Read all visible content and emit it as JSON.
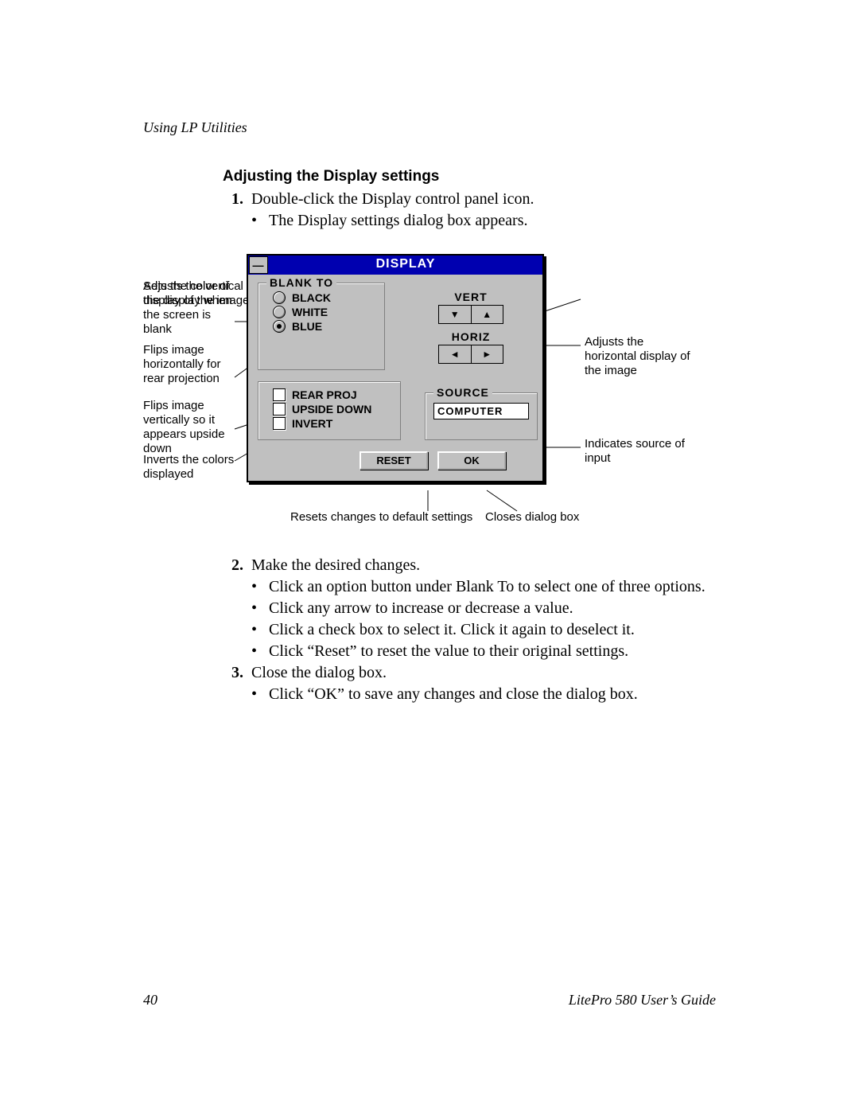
{
  "header": {
    "running": "Using LP Utilities"
  },
  "section": {
    "title": "Adjusting the Display settings"
  },
  "steps": {
    "s1": {
      "num": "1.",
      "text": "Double-click the Display control panel icon."
    },
    "s1a": {
      "text": "The Display settings dialog box appears."
    },
    "s2": {
      "num": "2.",
      "text": "Make the desired changes."
    },
    "s2a": {
      "text": "Click an option button under Blank To to select one of three options."
    },
    "s2b": {
      "text": "Click any arrow to increase or decrease a value."
    },
    "s2c": {
      "text": "Click a check box to select it. Click it again to deselect it."
    },
    "s2d": {
      "text": "Click “Reset” to reset the value to their original settings."
    },
    "s3": {
      "num": "3.",
      "text": "Close the dialog box."
    },
    "s3a": {
      "text": "Click “OK” to save any changes and close the dialog box."
    }
  },
  "dialog": {
    "title": "DISPLAY",
    "blank_to": {
      "legend": "BLANK TO",
      "black": "BLACK",
      "white": "WHITE",
      "blue": "BLUE"
    },
    "vert_label": "VERT",
    "horiz_label": "HORIZ",
    "checks": {
      "rear": "REAR PROJ",
      "upside": "UPSIDE DOWN",
      "invert": "INVERT"
    },
    "source": {
      "legend": "SOURCE",
      "value": "COMPUTER"
    },
    "buttons": {
      "reset": "RESET",
      "ok": "OK"
    }
  },
  "callouts": {
    "blankto": "Sets the color of the display when the screen is blank",
    "rear": "Flips image horizontally for rear projection",
    "upside": "Flips image vertically so it appears upside down",
    "invert": "Inverts the colors displayed",
    "vert": "Adjusts the vertical display of the image",
    "horiz": "Adjusts the horizontal display of the image",
    "source": "Indicates source of input",
    "reset": "Resets changes to default settings",
    "ok": "Closes dialog box"
  },
  "footer": {
    "page": "40",
    "guide": "LitePro 580 User’s Guide"
  }
}
